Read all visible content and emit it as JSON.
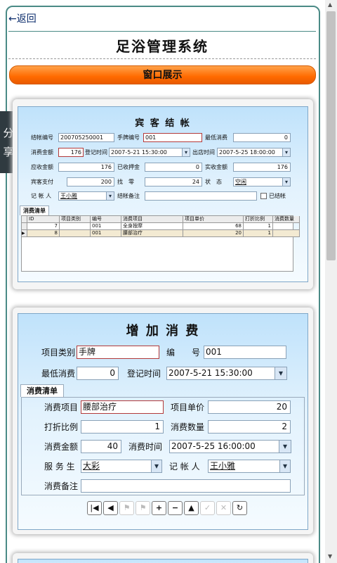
{
  "nav": {
    "back": "←返回"
  },
  "page_title": "足浴管理系统",
  "section_button": "窗口展示",
  "share": {
    "c1": "分",
    "c2": "享"
  },
  "checkout": {
    "title": "宾 客 结 帐",
    "labels": {
      "bill_no": "结帐编号",
      "tag_no": "手牌编号",
      "min_spend": "最低消费",
      "amount": "消费金额",
      "reg_time": "登记时间",
      "leave_time": "出店时间",
      "receivable": "应收金额",
      "deposit": "已收押金",
      "paid": "实收金额",
      "guest_pay": "宾客支付",
      "change": "找　零",
      "status": "状　态",
      "clerk": "记 帐 人",
      "remark": "结帐备注",
      "settled": "已结帐"
    },
    "values": {
      "bill_no": "200705250001",
      "tag_no": "001",
      "min_spend": "0",
      "amount": "176",
      "reg_time": "2007-5-21 15:30:00",
      "leave_time": "2007-5-25 18:00:00",
      "receivable": "176",
      "deposit": "0",
      "paid": "176",
      "guest_pay": "200",
      "change": "24",
      "status": "空闲",
      "clerk": "王小雅",
      "remark": ""
    },
    "tab": "消费清单",
    "columns": [
      "ID",
      "项目类别",
      "编号",
      "消费项目",
      "项目单价",
      "打折比例",
      "消费数量"
    ],
    "rows": [
      {
        "id": "7",
        "cat": "",
        "no": "001",
        "item": "全身按摩",
        "price": "68",
        "disc": "1",
        "qty": ""
      },
      {
        "id": "8",
        "cat": "",
        "no": "001",
        "item": "腰部治疗",
        "price": "20",
        "disc": "1",
        "qty": ""
      }
    ]
  },
  "addcons": {
    "title": "增 加 消 费",
    "labels": {
      "cat": "项目类别",
      "no": "编　　号",
      "min": "最低消费",
      "reg": "登记时间",
      "item": "消费项目",
      "price": "项目单价",
      "disc": "打折比例",
      "qty": "消费数量",
      "amt": "消费金额",
      "time": "消费时间",
      "waiter": "服 务 生",
      "clerk": "记 帐 人",
      "remark": "消费备注"
    },
    "values": {
      "cat": "手牌",
      "no": "001",
      "min": "0",
      "reg": "2007-5-21 15:30:00",
      "item": "腰部治疗",
      "price": "20",
      "disc": "1",
      "qty": "2",
      "amt": "40",
      "time": "2007-5-25 16:00:00",
      "waiter": "大彩",
      "clerk": "王小雅",
      "remark": ""
    },
    "tab": "消费清单"
  }
}
